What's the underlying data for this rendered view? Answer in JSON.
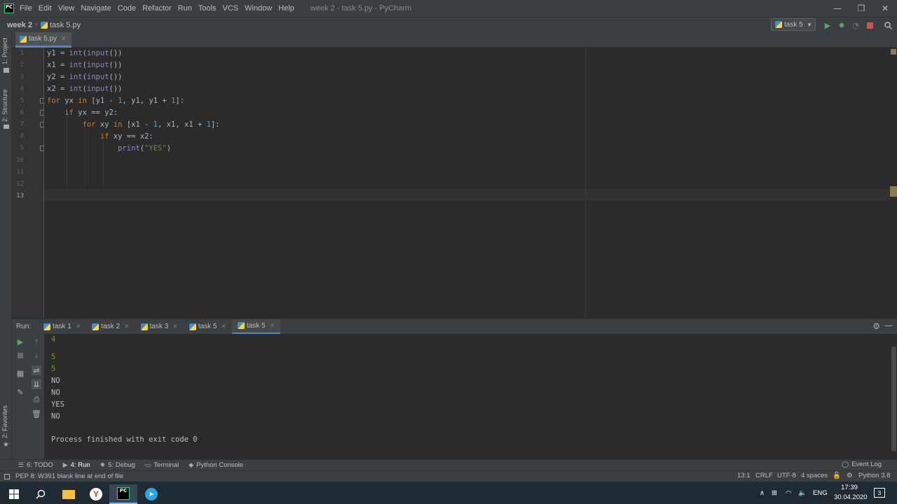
{
  "titlebar": {
    "logo": "PC",
    "menu": [
      "File",
      "Edit",
      "View",
      "Navigate",
      "Code",
      "Refactor",
      "Run",
      "Tools",
      "VCS",
      "Window",
      "Help"
    ],
    "window_title": "week 2 - task 5.py - PyCharm",
    "controls": [
      "—",
      "❐",
      "✕"
    ]
  },
  "navbar": {
    "project": "week 2",
    "file": "task 5.py",
    "run_config": "task 5"
  },
  "left_strip": {
    "project_tab": "1: Project",
    "structure_tab": "2: Structure",
    "favorites_tab": "2: Favorites"
  },
  "editor": {
    "tab": "task 5.py",
    "line_numbers": [
      "1",
      "2",
      "3",
      "4",
      "5",
      "6",
      "7",
      "8",
      "9",
      "10",
      "11",
      "12",
      "13"
    ],
    "current_line": "13"
  },
  "code": {
    "l1": {
      "a": "y1 = ",
      "f": "int",
      "b": "(",
      "f2": "input",
      "c": "())"
    },
    "l2": {
      "a": "x1 = ",
      "f": "int",
      "b": "(",
      "f2": "input",
      "c": "())"
    },
    "l3": {
      "a": "y2 = ",
      "f": "int",
      "b": "(",
      "f2": "input",
      "c": "())"
    },
    "l4": {
      "a": "x2 = ",
      "f": "int",
      "b": "(",
      "f2": "input",
      "c": "())"
    },
    "l5": {
      "k1": "for",
      "a": " yx ",
      "k2": "in",
      "b": " [y1 - ",
      "n1": "1",
      "c": ", y1, y1 + ",
      "n2": "1",
      "d": "]:"
    },
    "l6": {
      "ind": "    ",
      "k1": "if",
      "a": " yx == y2:"
    },
    "l7": {
      "ind": "        ",
      "k1": "for",
      "a": " xy ",
      "k2": "in",
      "b": " [x1 - ",
      "n1": "1",
      "c": ", x1, x1 + ",
      "n2": "1",
      "d": "]:"
    },
    "l8": {
      "ind": "            ",
      "k1": "if",
      "a": " xy == x2:"
    },
    "l9": {
      "ind": "                ",
      "f": "print",
      "a": "(",
      "s": "\"YES\"",
      "b": ")"
    }
  },
  "run": {
    "label": "Run:",
    "tabs": [
      "task 1",
      "task 2",
      "task 3",
      "task 5",
      "task 5"
    ],
    "output": [
      {
        "text": "4",
        "kind": "in"
      },
      {
        "text": "5",
        "kind": "in"
      },
      {
        "text": "5",
        "kind": "in"
      },
      {
        "text": "NO",
        "kind": "norm"
      },
      {
        "text": "NO",
        "kind": "norm"
      },
      {
        "text": "YES",
        "kind": "norm"
      },
      {
        "text": "NO",
        "kind": "norm"
      },
      {
        "text": "",
        "kind": "norm"
      },
      {
        "text": "Process finished with exit code 0",
        "kind": "norm"
      }
    ]
  },
  "toolwindows": {
    "todo": "6: TODO",
    "run": "4: Run",
    "debug": "5: Debug",
    "terminal": "Terminal",
    "python_console": "Python Console",
    "event_log": "Event Log"
  },
  "status": {
    "message": "PEP 8: W391 blank line at end of file",
    "position": "13:1",
    "line_sep": "CRLF",
    "encoding": "UTF-8",
    "indent": "4 spaces",
    "interpreter": "Python 3.8"
  },
  "taskbar": {
    "lang": "ENG",
    "time": "17:39",
    "date": "30.04.2020",
    "notifications": "3"
  },
  "colors": {
    "accent": "#4a88c7",
    "run_green": "#59a869",
    "stop_red": "#c75450"
  }
}
